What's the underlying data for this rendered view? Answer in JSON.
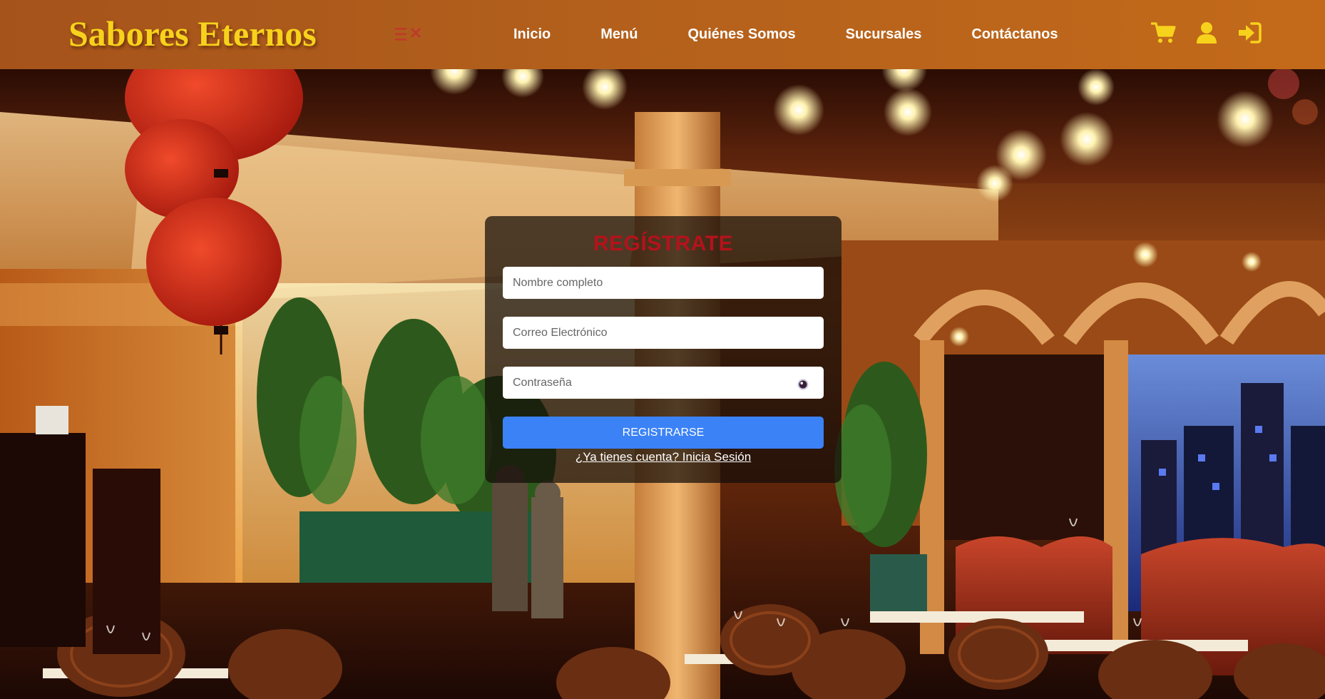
{
  "header": {
    "brand": "Sabores Eternos",
    "menu_toggle_color": "#c0392b",
    "nav": [
      {
        "label": "Inicio"
      },
      {
        "label": "Menú"
      },
      {
        "label": "Quiénes Somos"
      },
      {
        "label": "Sucursales"
      },
      {
        "label": "Contáctanos"
      }
    ],
    "icons": [
      "cart-icon",
      "user-icon",
      "sign-in-icon"
    ],
    "icon_color": "#f7d21c"
  },
  "register": {
    "title": "REGÍSTRATE",
    "name_placeholder": "Nombre completo",
    "email_placeholder": "Correo Electrónico",
    "password_placeholder": "Contraseña",
    "submit_label": "REGISTRARSE",
    "login_link": "¿Ya tienes cuenta? Inicia Sesión"
  },
  "colors": {
    "header": "#b3601c",
    "brand": "#f7d21c",
    "title": "#b5121b",
    "button": "#3b82f6"
  }
}
